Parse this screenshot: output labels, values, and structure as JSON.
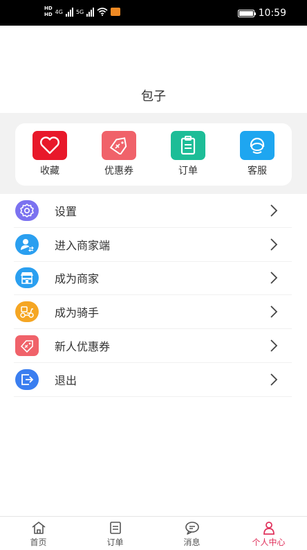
{
  "status_bar": {
    "hd1": "HD",
    "hd2": "HD",
    "net1": "4G",
    "net2": "5G",
    "time": "10:59"
  },
  "profile": {
    "name": "包子"
  },
  "quick_actions": [
    {
      "label": "收藏",
      "icon": "heart-icon",
      "color": "#e8182a"
    },
    {
      "label": "优惠券",
      "icon": "coupon-tag-icon",
      "color": "#f0626a"
    },
    {
      "label": "订单",
      "icon": "clipboard-icon",
      "color": "#1dbd97"
    },
    {
      "label": "客服",
      "icon": "headset-icon",
      "color": "#1ea6f0"
    }
  ],
  "menu": [
    {
      "label": "设置",
      "icon": "gear-icon",
      "color": "#7b72f0"
    },
    {
      "label": "进入商家端",
      "icon": "user-switch-icon",
      "color": "#2a9ff0"
    },
    {
      "label": "成为商家",
      "icon": "store-icon",
      "color": "#2a9ff0"
    },
    {
      "label": "成为骑手",
      "icon": "scooter-icon",
      "color": "#f5a623"
    },
    {
      "label": "新人优惠券",
      "icon": "coupon-tag-icon",
      "color": "#f0626a"
    },
    {
      "label": "退出",
      "icon": "logout-icon",
      "color": "#3a7ef0"
    }
  ],
  "tabbar": [
    {
      "label": "首页",
      "icon": "home-icon",
      "active": false
    },
    {
      "label": "订单",
      "icon": "order-icon",
      "active": false
    },
    {
      "label": "消息",
      "icon": "message-icon",
      "active": false
    },
    {
      "label": "个人中心",
      "icon": "person-icon",
      "active": true
    }
  ],
  "colors": {
    "accent": "#e0325c",
    "band": "#f2f2f2"
  }
}
